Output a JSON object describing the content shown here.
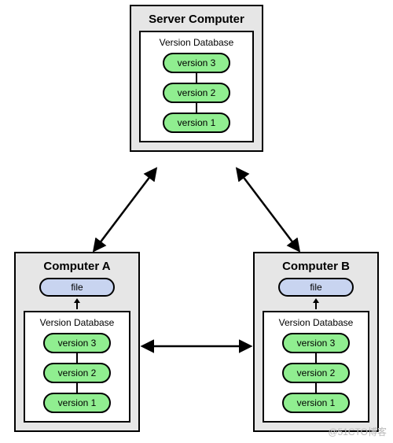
{
  "server": {
    "title": "Server Computer",
    "db_label": "Version Database",
    "versions": [
      "version 3",
      "version 2",
      "version 1"
    ]
  },
  "computerA": {
    "title": "Computer A",
    "file_label": "file",
    "db_label": "Version Database",
    "versions": [
      "version 3",
      "version 2",
      "version 1"
    ]
  },
  "computerB": {
    "title": "Computer B",
    "file_label": "file",
    "db_label": "Version Database",
    "versions": [
      "version 3",
      "version 2",
      "version 1"
    ]
  },
  "watermark": "@51CTO博客"
}
